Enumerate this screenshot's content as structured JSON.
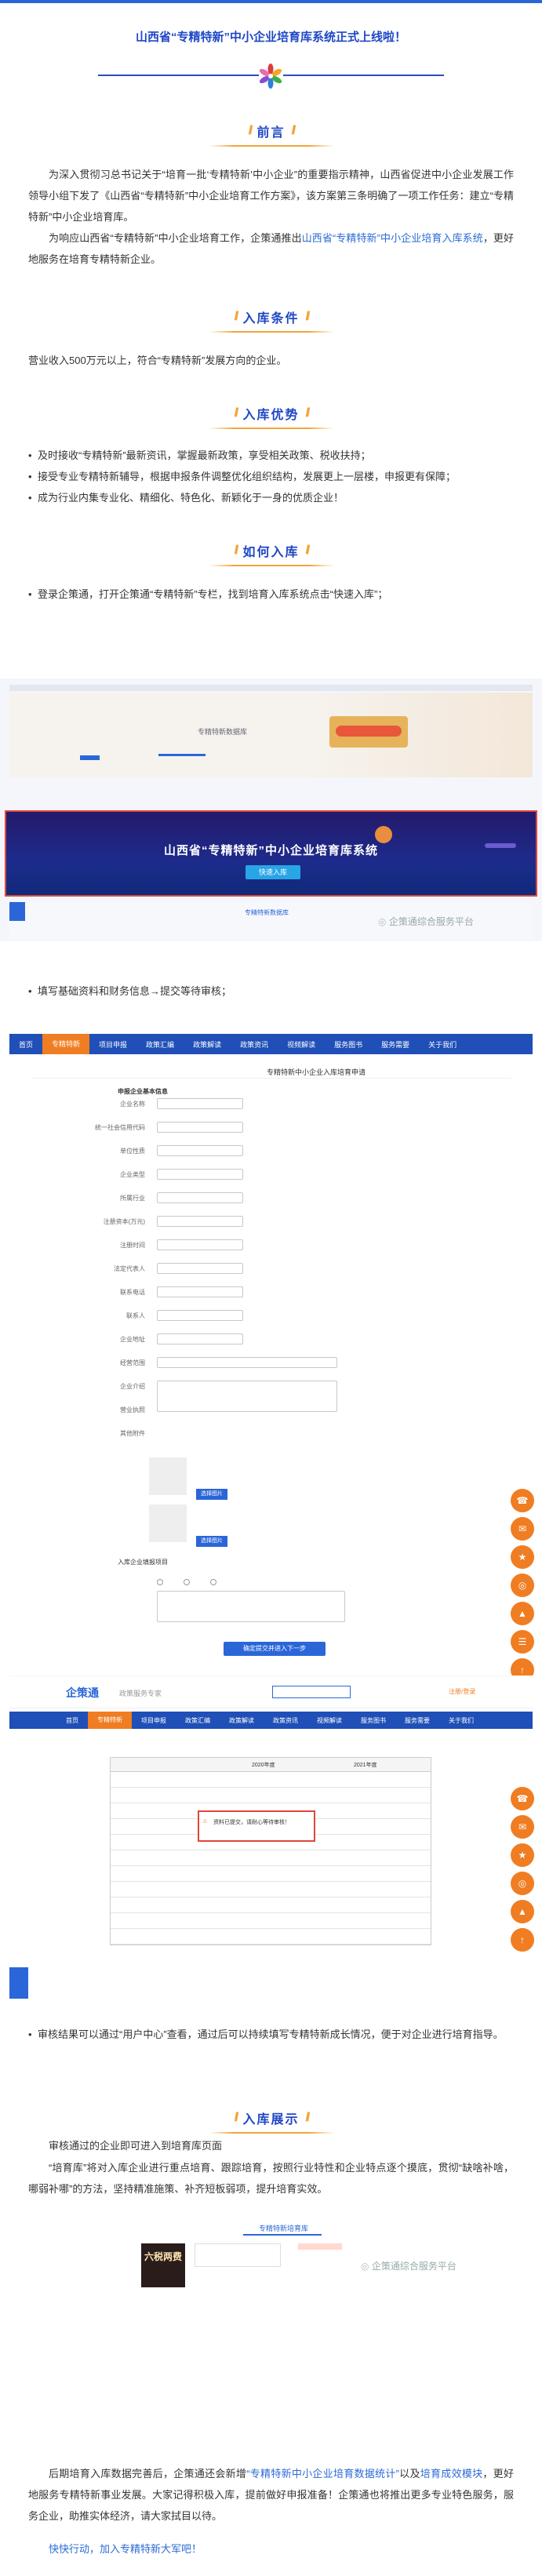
{
  "title": "山西省“专精特新”中小企业培育库系统正式上线啦！",
  "sections": {
    "preface": "前言",
    "conditions": "入库条件",
    "advantages": "入库优势",
    "how": "如何入库",
    "showcase": "入库展示"
  },
  "preface_p1": "为深入贯彻习总书记关于“培育一批‘专精特新’中小企业”的重要指示精神，山西省促进中小企业发展工作领导小组下发了《山西省“专精特新”中小企业培育工作方案》，该方案第三条明确了一项工作任务：建立“专精特新”中小企业培育库。",
  "preface_p2_a": "为响应山西省“专精特新”中小企业培育工作，企策通推出",
  "preface_p2_link": "山西省“专精特新”中小企业培育入库系统",
  "preface_p2_b": "，更好地服务在培育专精特新企业。",
  "conditions_text": "营业收入500万元以上，符合“专精特新”发展方向的企业。",
  "advantages": [
    "及时接收“专精特新”最新资讯，掌握最新政策，享受相关政策、税收扶持；",
    "接受专业专精特新辅导，根据申报条件调整优化组织结构，发展更上一层楼，申报更有保障；",
    "成为行业内集专业化、精细化、特色化、新颖化于一身的优质企业！"
  ],
  "how_step1": "登录企策通，打开企策通“专精特新”专栏，找到培育入库系统点击“快速入库”；",
  "how_step2": "填写基础资料和财务信息→提交等待审核；",
  "how_step3": "审核结果可以通过“用户中心”查看，通过后可以持续填写专精特新成长情况，便于对企业进行培育指导。",
  "showcase_p1": "审核通过的企业即可进入到培育库页面",
  "showcase_p2": "“培育库”将对入库企业进行重点培育、跟踪培育，按照行业特性和企业特点逐个摸底，贯彻“缺啥补啥，哪弱补哪”的方法，坚持精准施策、补齐短板弱项，提升培育实效。",
  "closing_a": "后期培育入库数据完善后，企策通还会新增",
  "closing_link1": "“专精特新中小企业培育数据统计”",
  "closing_mid": "以及",
  "closing_link2": "培育成效模块",
  "closing_b": "，更好地服务专精特新事业发展。大家记得积极入库，提前做好申报准备！企策通也将推出更多专业特色服务，服务企业，助推实体经济，请大家拭目以待。",
  "cta": "快快行动，加入专精特新大军吧！",
  "screens": {
    "banner_text": "山西省“专精特新”中小企业培育库系统",
    "banner_btn": "快速入库",
    "small_tag": "专精特新数据库",
    "watermark": "企策通综合服务平台",
    "nav_items": [
      "首页",
      "专精特新",
      "项目申报",
      "政策汇编",
      "政策解读",
      "政策资讯",
      "视频解读",
      "服务图书",
      "服务需要",
      "关于我们"
    ],
    "form_title": "专精特新中小企业入库培育申请",
    "form_section1": "申报企业基本信息",
    "form_fields": [
      "企业名称",
      "统一社会信用代码",
      "单位性质",
      "企业类型",
      "所属行业",
      "注册资本(万元)",
      "注册时间",
      "法定代表人",
      "联系电话",
      "联系人",
      "企业地址",
      "经营范围",
      "企业介绍",
      "营业执照",
      "其他附件"
    ],
    "form_section2": "入库企业填报项目",
    "form_submit": "确定提交并进入下一步",
    "upload_btn": "选择图片",
    "logo_text": "企策通",
    "slogan": "政策服务专家",
    "login": "注册/登录",
    "dialog_text": "资料已提交，请耐心等待审核！",
    "table_header_a": "2020年度",
    "table_header_b": "2021年度",
    "showcase_title": "专精特新培育库",
    "showcase_card": "六税两费"
  }
}
